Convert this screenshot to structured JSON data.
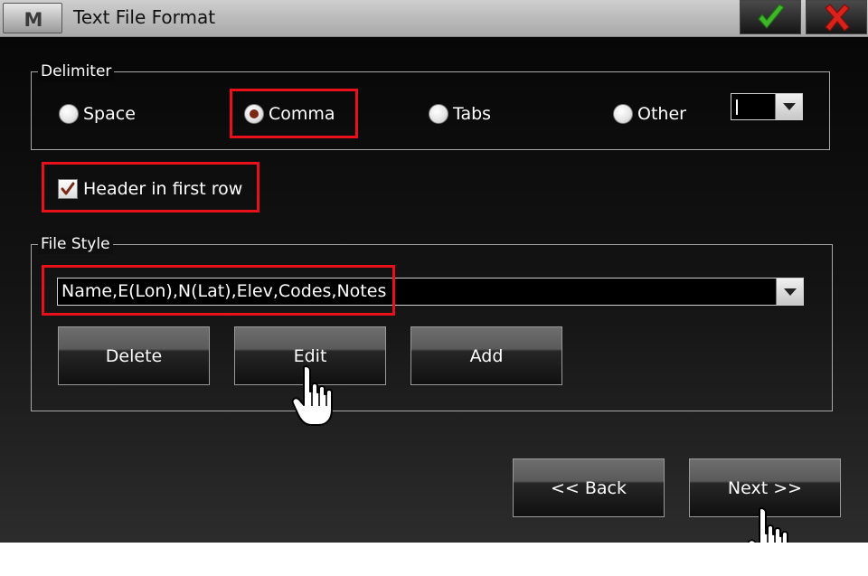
{
  "window": {
    "title": "Text File Format",
    "menu_glyph": "M",
    "accent_ok": "#3fb52a",
    "accent_cancel": "#d8221b"
  },
  "delimiter": {
    "legend": "Delimiter",
    "options": [
      {
        "label": "Space",
        "selected": false
      },
      {
        "label": "Comma",
        "selected": true
      },
      {
        "label": "Tabs",
        "selected": false
      },
      {
        "label": "Other",
        "selected": false
      }
    ],
    "other_value": ""
  },
  "header_row": {
    "label": "Header in first row",
    "checked": true
  },
  "file_style": {
    "legend": "File Style",
    "selected_value": "Name,E(Lon),N(Lat),Elev,Codes,Notes",
    "buttons": {
      "delete": "Delete",
      "edit": "Edit",
      "add": "Add"
    }
  },
  "navigation": {
    "back": "<< Back",
    "next": "Next >>"
  },
  "annotations": {
    "highlight_color": "#e8101a"
  }
}
